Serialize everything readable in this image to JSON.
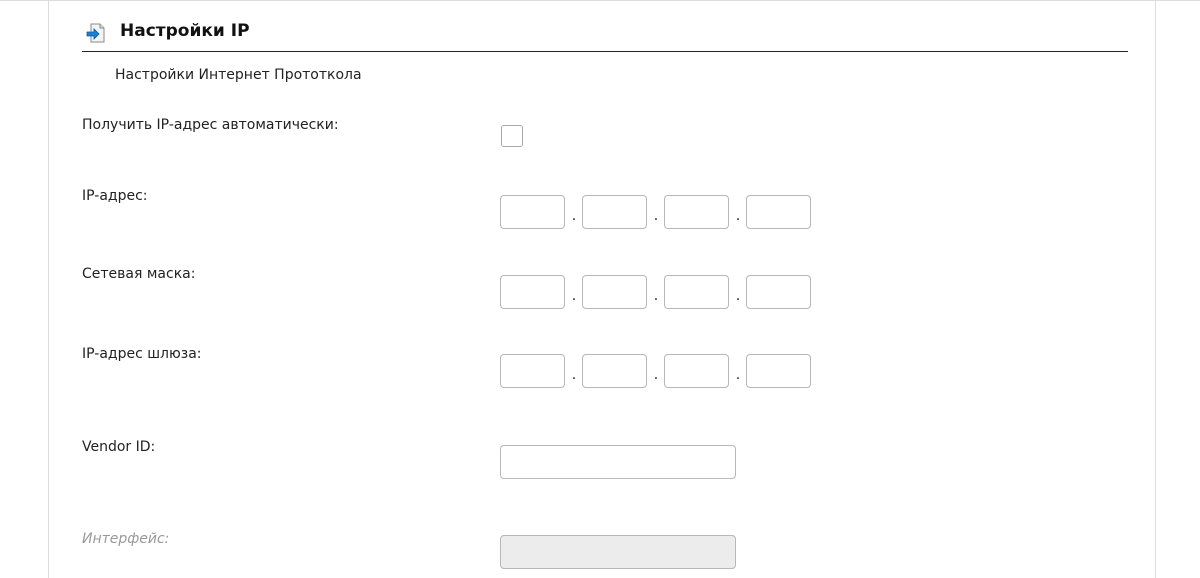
{
  "section": {
    "title": "Настройки IP",
    "subtitle": "Настройки Интернет Прототкола"
  },
  "fields": {
    "auto_ip": {
      "label": "Получить IP-адрес автоматически:",
      "checked": false
    },
    "ip_address": {
      "label": "IP-адрес:",
      "octets": [
        "",
        "",
        "",
        ""
      ],
      "separator": "."
    },
    "netmask": {
      "label": "Сетевая маска:",
      "octets": [
        "",
        "",
        "",
        ""
      ],
      "separator": "."
    },
    "gateway": {
      "label": "IP-адрес шлюза:",
      "octets": [
        "",
        "",
        "",
        ""
      ],
      "separator": "."
    },
    "vendor_id": {
      "label": "Vendor ID:",
      "value": ""
    },
    "interface": {
      "label": "Интерфейс:",
      "value": "",
      "disabled": true
    }
  },
  "colors": {
    "header_icon_blue": "#1a7fd6",
    "border": "#b7b7b7",
    "disabled_bg": "#ececec",
    "disabled_text": "#999999"
  },
  "icons": {
    "header": "document-arrow-icon"
  }
}
